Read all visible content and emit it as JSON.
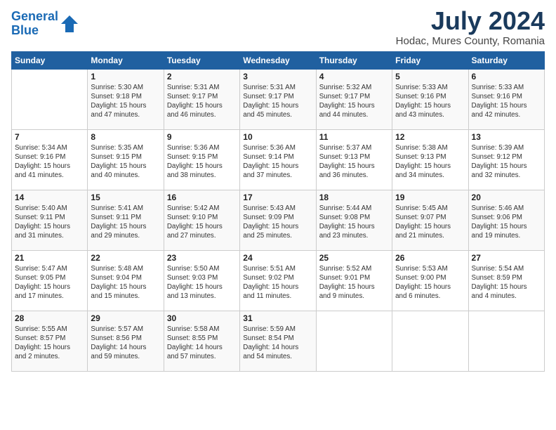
{
  "header": {
    "logo_line1": "General",
    "logo_line2": "Blue",
    "title": "July 2024",
    "subtitle": "Hodac, Mures County, Romania"
  },
  "weekdays": [
    "Sunday",
    "Monday",
    "Tuesday",
    "Wednesday",
    "Thursday",
    "Friday",
    "Saturday"
  ],
  "weeks": [
    [
      {
        "day": "",
        "info": ""
      },
      {
        "day": "1",
        "info": "Sunrise: 5:30 AM\nSunset: 9:18 PM\nDaylight: 15 hours\nand 47 minutes."
      },
      {
        "day": "2",
        "info": "Sunrise: 5:31 AM\nSunset: 9:17 PM\nDaylight: 15 hours\nand 46 minutes."
      },
      {
        "day": "3",
        "info": "Sunrise: 5:31 AM\nSunset: 9:17 PM\nDaylight: 15 hours\nand 45 minutes."
      },
      {
        "day": "4",
        "info": "Sunrise: 5:32 AM\nSunset: 9:17 PM\nDaylight: 15 hours\nand 44 minutes."
      },
      {
        "day": "5",
        "info": "Sunrise: 5:33 AM\nSunset: 9:16 PM\nDaylight: 15 hours\nand 43 minutes."
      },
      {
        "day": "6",
        "info": "Sunrise: 5:33 AM\nSunset: 9:16 PM\nDaylight: 15 hours\nand 42 minutes."
      }
    ],
    [
      {
        "day": "7",
        "info": "Sunrise: 5:34 AM\nSunset: 9:16 PM\nDaylight: 15 hours\nand 41 minutes."
      },
      {
        "day": "8",
        "info": "Sunrise: 5:35 AM\nSunset: 9:15 PM\nDaylight: 15 hours\nand 40 minutes."
      },
      {
        "day": "9",
        "info": "Sunrise: 5:36 AM\nSunset: 9:15 PM\nDaylight: 15 hours\nand 38 minutes."
      },
      {
        "day": "10",
        "info": "Sunrise: 5:36 AM\nSunset: 9:14 PM\nDaylight: 15 hours\nand 37 minutes."
      },
      {
        "day": "11",
        "info": "Sunrise: 5:37 AM\nSunset: 9:13 PM\nDaylight: 15 hours\nand 36 minutes."
      },
      {
        "day": "12",
        "info": "Sunrise: 5:38 AM\nSunset: 9:13 PM\nDaylight: 15 hours\nand 34 minutes."
      },
      {
        "day": "13",
        "info": "Sunrise: 5:39 AM\nSunset: 9:12 PM\nDaylight: 15 hours\nand 32 minutes."
      }
    ],
    [
      {
        "day": "14",
        "info": "Sunrise: 5:40 AM\nSunset: 9:11 PM\nDaylight: 15 hours\nand 31 minutes."
      },
      {
        "day": "15",
        "info": "Sunrise: 5:41 AM\nSunset: 9:11 PM\nDaylight: 15 hours\nand 29 minutes."
      },
      {
        "day": "16",
        "info": "Sunrise: 5:42 AM\nSunset: 9:10 PM\nDaylight: 15 hours\nand 27 minutes."
      },
      {
        "day": "17",
        "info": "Sunrise: 5:43 AM\nSunset: 9:09 PM\nDaylight: 15 hours\nand 25 minutes."
      },
      {
        "day": "18",
        "info": "Sunrise: 5:44 AM\nSunset: 9:08 PM\nDaylight: 15 hours\nand 23 minutes."
      },
      {
        "day": "19",
        "info": "Sunrise: 5:45 AM\nSunset: 9:07 PM\nDaylight: 15 hours\nand 21 minutes."
      },
      {
        "day": "20",
        "info": "Sunrise: 5:46 AM\nSunset: 9:06 PM\nDaylight: 15 hours\nand 19 minutes."
      }
    ],
    [
      {
        "day": "21",
        "info": "Sunrise: 5:47 AM\nSunset: 9:05 PM\nDaylight: 15 hours\nand 17 minutes."
      },
      {
        "day": "22",
        "info": "Sunrise: 5:48 AM\nSunset: 9:04 PM\nDaylight: 15 hours\nand 15 minutes."
      },
      {
        "day": "23",
        "info": "Sunrise: 5:50 AM\nSunset: 9:03 PM\nDaylight: 15 hours\nand 13 minutes."
      },
      {
        "day": "24",
        "info": "Sunrise: 5:51 AM\nSunset: 9:02 PM\nDaylight: 15 hours\nand 11 minutes."
      },
      {
        "day": "25",
        "info": "Sunrise: 5:52 AM\nSunset: 9:01 PM\nDaylight: 15 hours\nand 9 minutes."
      },
      {
        "day": "26",
        "info": "Sunrise: 5:53 AM\nSunset: 9:00 PM\nDaylight: 15 hours\nand 6 minutes."
      },
      {
        "day": "27",
        "info": "Sunrise: 5:54 AM\nSunset: 8:59 PM\nDaylight: 15 hours\nand 4 minutes."
      }
    ],
    [
      {
        "day": "28",
        "info": "Sunrise: 5:55 AM\nSunset: 8:57 PM\nDaylight: 15 hours\nand 2 minutes."
      },
      {
        "day": "29",
        "info": "Sunrise: 5:57 AM\nSunset: 8:56 PM\nDaylight: 14 hours\nand 59 minutes."
      },
      {
        "day": "30",
        "info": "Sunrise: 5:58 AM\nSunset: 8:55 PM\nDaylight: 14 hours\nand 57 minutes."
      },
      {
        "day": "31",
        "info": "Sunrise: 5:59 AM\nSunset: 8:54 PM\nDaylight: 14 hours\nand 54 minutes."
      },
      {
        "day": "",
        "info": ""
      },
      {
        "day": "",
        "info": ""
      },
      {
        "day": "",
        "info": ""
      }
    ]
  ]
}
